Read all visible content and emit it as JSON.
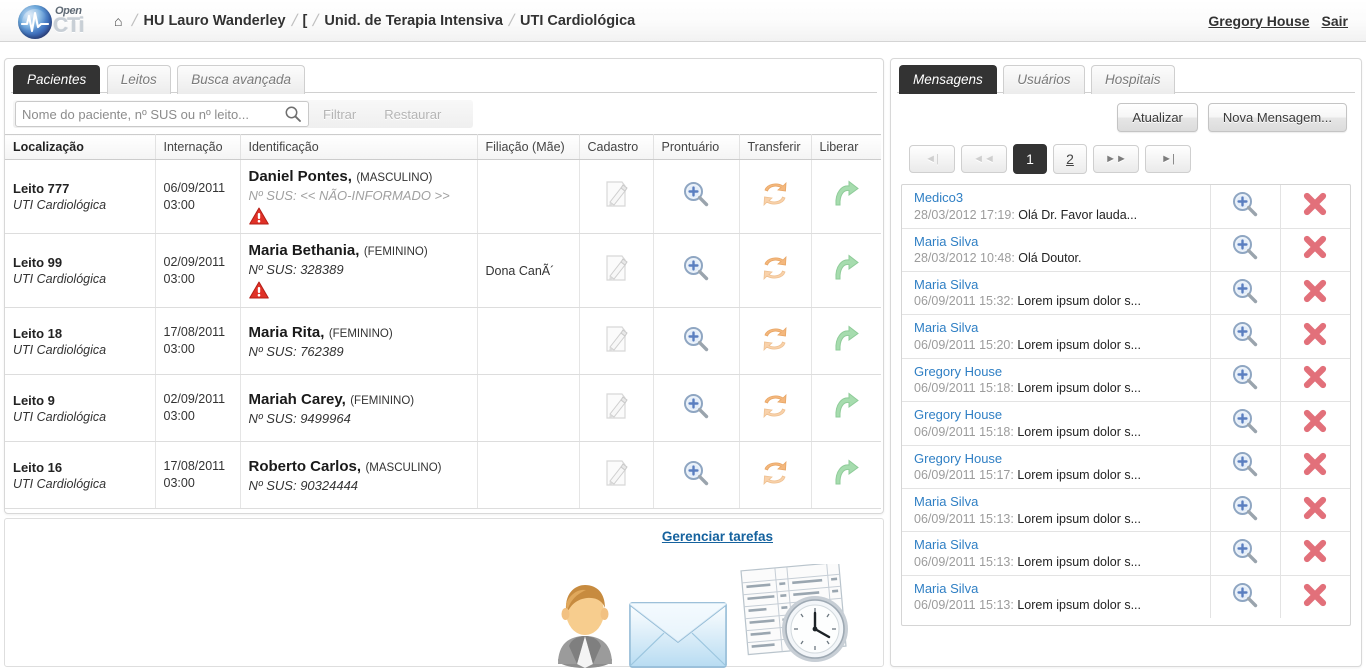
{
  "header": {
    "logo": {
      "word_top": "Open",
      "word_bottom": "CTi"
    },
    "home_icon": "⌂",
    "breadcrumb": [
      "HU Lauro Wanderley",
      "[",
      "Unid. de Terapia Intensiva",
      "UTI Cardiológica"
    ],
    "user_name": "Gregory House",
    "logout_label": "Sair"
  },
  "left": {
    "tabs": [
      {
        "label": "Pacientes",
        "active": true
      },
      {
        "label": "Leitos",
        "active": false
      },
      {
        "label": "Busca avançada",
        "active": false
      }
    ],
    "search": {
      "placeholder": "Nome do paciente, nº SUS ou nº leito...",
      "value": "",
      "filter_label": "Filtrar",
      "restore_label": "Restaurar"
    },
    "table": {
      "columns": [
        "Localização",
        "Internação",
        "Identificação",
        "Filiação (Mãe)",
        "Cadastro",
        "Prontuário",
        "Transferir",
        "Liberar"
      ],
      "rows": [
        {
          "bed": "Leito 777",
          "unit": "UTI Cardiológica",
          "adm_date": "06/09/2011",
          "adm_time": "03:00",
          "name": "Daniel Pontes,",
          "sex": "(MASCULINO)",
          "sus": "Nº SUS: << NÃO-INFORMADO >>",
          "sus_unknown": true,
          "warning": true,
          "filiacao": ""
        },
        {
          "bed": "Leito 99",
          "unit": "UTI Cardiológica",
          "adm_date": "02/09/2011",
          "adm_time": "03:00",
          "name": "Maria Bethania,",
          "sex": "(FEMININO)",
          "sus": "Nº SUS: 328389",
          "sus_unknown": false,
          "warning": true,
          "filiacao": "Dona CanÃ´"
        },
        {
          "bed": "Leito 18",
          "unit": "UTI Cardiológica",
          "adm_date": "17/08/2011",
          "adm_time": "03:00",
          "name": "Maria Rita,",
          "sex": "(FEMININO)",
          "sus": "Nº SUS: 762389",
          "sus_unknown": false,
          "warning": false,
          "filiacao": ""
        },
        {
          "bed": "Leito 9",
          "unit": "UTI Cardiológica",
          "adm_date": "02/09/2011",
          "adm_time": "03:00",
          "name": "Mariah Carey,",
          "sex": "(FEMININO)",
          "sus": "Nº SUS: 9499964",
          "sus_unknown": false,
          "warning": false,
          "filiacao": ""
        },
        {
          "bed": "Leito 16",
          "unit": "UTI Cardiológica",
          "adm_date": "17/08/2011",
          "adm_time": "03:00",
          "name": "Roberto Carlos,",
          "sex": "(MASCULINO)",
          "sus": "Nº SUS: 90324444",
          "sus_unknown": false,
          "warning": false,
          "filiacao": ""
        }
      ]
    },
    "tasks_link": "Gerenciar tarefas",
    "decorations": [
      "user-avatar-icon",
      "envelope-icon",
      "schedule-clock-icon"
    ]
  },
  "right": {
    "tabs": [
      {
        "label": "Mensagens",
        "active": true
      },
      {
        "label": "Usuários",
        "active": false
      },
      {
        "label": "Hospitais",
        "active": false
      }
    ],
    "toolbar": {
      "refresh_label": "Atualizar",
      "new_message_label": "Nova Mensagem..."
    },
    "pager": {
      "first_label": "◄|",
      "prev_label": "◄◄",
      "next_label": "►►",
      "last_label": "►|",
      "pages": [
        "1",
        "2"
      ],
      "current": "1"
    },
    "messages": [
      {
        "sender": "Medico3",
        "time": "28/03/2012 17:19",
        "preview": "Olá Dr. Favor lauda..."
      },
      {
        "sender": "Maria Silva",
        "time": "28/03/2012 10:48",
        "preview": "Olá Doutor."
      },
      {
        "sender": "Maria Silva",
        "time": "06/09/2011 15:32",
        "preview": "Lorem ipsum dolor s..."
      },
      {
        "sender": "Maria Silva",
        "time": "06/09/2011 15:20",
        "preview": "Lorem ipsum dolor s..."
      },
      {
        "sender": "Gregory House",
        "time": "06/09/2011 15:18",
        "preview": "Lorem ipsum dolor s..."
      },
      {
        "sender": "Gregory House",
        "time": "06/09/2011 15:18",
        "preview": "Lorem ipsum dolor s..."
      },
      {
        "sender": "Gregory House",
        "time": "06/09/2011 15:17",
        "preview": "Lorem ipsum dolor s..."
      },
      {
        "sender": "Maria Silva",
        "time": "06/09/2011 15:13",
        "preview": "Lorem ipsum dolor s..."
      },
      {
        "sender": "Maria Silva",
        "time": "06/09/2011 15:13",
        "preview": "Lorem ipsum dolor s..."
      },
      {
        "sender": "Maria Silva",
        "time": "06/09/2011 15:13",
        "preview": "Lorem ipsum dolor s..."
      }
    ]
  },
  "colors": {
    "tab_active_bg": "#333333",
    "link_blue": "#2f7fc4",
    "task_link_blue": "#15629e",
    "warning_red": "#e03127",
    "delete_red": "#e2707a",
    "transfer_orange": "#f0b27a",
    "release_green": "#9ed3a4"
  }
}
